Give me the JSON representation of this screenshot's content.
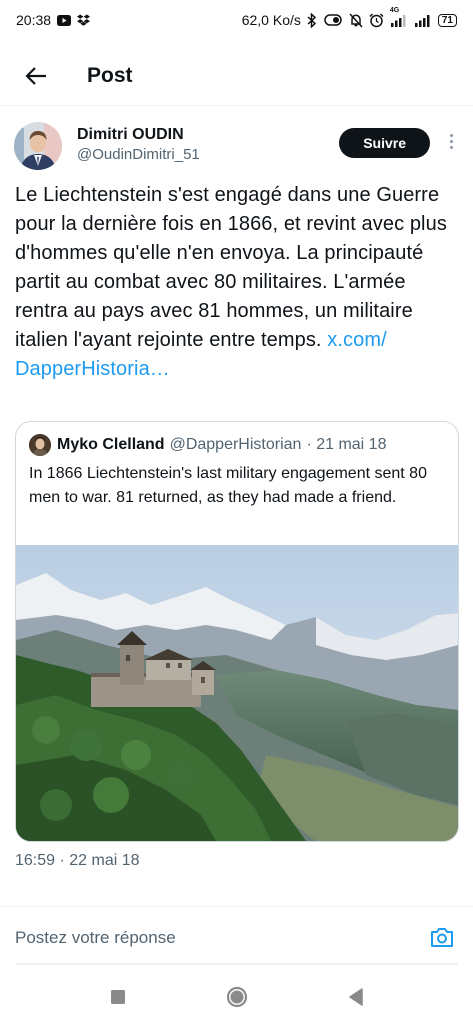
{
  "status_bar": {
    "time": "20:38",
    "network_speed": "62,0 Ko/s",
    "network_type": "4G",
    "battery": "71"
  },
  "header": {
    "title": "Post"
  },
  "post": {
    "author_name": "Dimitri OUDIN",
    "author_handle": "@OudinDimitri_51",
    "follow_label": "Suivre",
    "text": "Le Liechtenstein s'est engagé dans une Guerre pour la dernière fois en 1866, et revint avec plus d'hommes qu'elle n'en envoya. La principauté partit au combat avec 80 militaires. L'armée rentra au pays avec 81 hommes, un militaire italien l'ayant rejointe entre temps.",
    "link": "x.com/ DapperHistoria…",
    "timestamp": "16:59 · 22 mai 18"
  },
  "quote": {
    "author_name": "Myko Clelland",
    "author_handle": "@DapperHistorian",
    "date": "· 21 mai 18",
    "text": "In 1866 Liechtenstein's last military engagement sent 80 men to war. 81 returned, as they had made a friend."
  },
  "reply": {
    "placeholder": "Postez votre réponse"
  },
  "colors": {
    "link": "#1d9bf0",
    "secondary_text": "#536471",
    "follow_button": "#0f1419"
  },
  "icons": {
    "back": "arrow-left-icon",
    "more": "vertical-dots-icon",
    "camera": "camera-icon",
    "nav_recents": "square-icon",
    "nav_home": "circle-icon",
    "nav_back": "triangle-back-icon"
  }
}
